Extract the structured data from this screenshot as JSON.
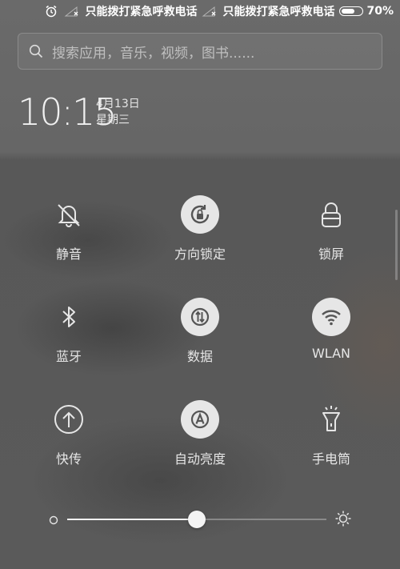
{
  "status_bar": {
    "carrier_1": "只能拨打紧急呼救电话",
    "carrier_2": "只能拨打紧急呼救电话",
    "battery_text": "70%",
    "battery_level": 0.7,
    "icons": [
      "alarm-icon",
      "signal-none-icon",
      "signal-none-icon",
      "battery-icon"
    ]
  },
  "search": {
    "placeholder": "搜索应用，音乐，视频，图书......"
  },
  "clock": {
    "time": "10:15",
    "date": "4月13日",
    "weekday": "星期三"
  },
  "toggles": [
    {
      "label": "静音",
      "icon": "bell-off-icon",
      "active": false
    },
    {
      "label": "方向锁定",
      "icon": "rotation-lock-icon",
      "active": true
    },
    {
      "label": "锁屏",
      "icon": "lock-icon",
      "active": false
    },
    {
      "label": "蓝牙",
      "icon": "bluetooth-icon",
      "active": false
    },
    {
      "label": "数据",
      "icon": "mobile-data-icon",
      "active": true
    },
    {
      "label": "WLAN",
      "icon": "wifi-icon",
      "active": true
    },
    {
      "label": "快传",
      "icon": "quick-transfer-icon",
      "active": false
    },
    {
      "label": "自动亮度",
      "icon": "auto-brightness-icon",
      "active": true
    },
    {
      "label": "手电筒",
      "icon": "flashlight-icon",
      "active": false
    }
  ],
  "brightness": {
    "level": 0.5
  },
  "colors": {
    "panel_bg": "#5a5a5a",
    "active_icon_bg": "#e6e6e6",
    "text": "#e6e6e6"
  }
}
